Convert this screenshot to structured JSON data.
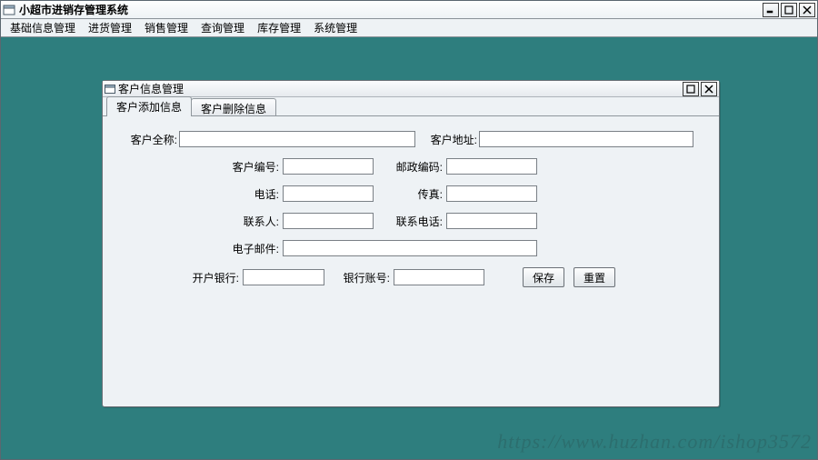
{
  "app": {
    "title": "小超市进销存管理系统",
    "menubar": [
      "基础信息管理",
      "进货管理",
      "销售管理",
      "查询管理",
      "库存管理",
      "系统管理"
    ]
  },
  "window": {
    "title": "客户信息管理",
    "tabs": [
      {
        "label": "客户添加信息",
        "active": true
      },
      {
        "label": "客户删除信息",
        "active": false
      }
    ]
  },
  "form": {
    "full_name_label": "客户全称:",
    "full_name_value": "",
    "address_label": "客户地址:",
    "address_value": "",
    "customer_no_label": "客户编号:",
    "customer_no_value": "",
    "postcode_label": "邮政编码:",
    "postcode_value": "",
    "phone_label": "电话:",
    "phone_value": "",
    "fax_label": "传真:",
    "fax_value": "",
    "contact_label": "联系人:",
    "contact_value": "",
    "contact_phone_label": "联系电话:",
    "contact_phone_value": "",
    "email_label": "电子邮件:",
    "email_value": "",
    "bank_label": "开户银行:",
    "bank_value": "",
    "bank_account_label": "银行账号:",
    "bank_account_value": "",
    "save_label": "保存",
    "reset_label": "重置"
  },
  "watermark": "https://www.huzhan.com/ishop3572",
  "colors": {
    "desktop_bg": "#2e7e7e",
    "panel_bg": "#eef2f5",
    "border": "#6b7177"
  }
}
